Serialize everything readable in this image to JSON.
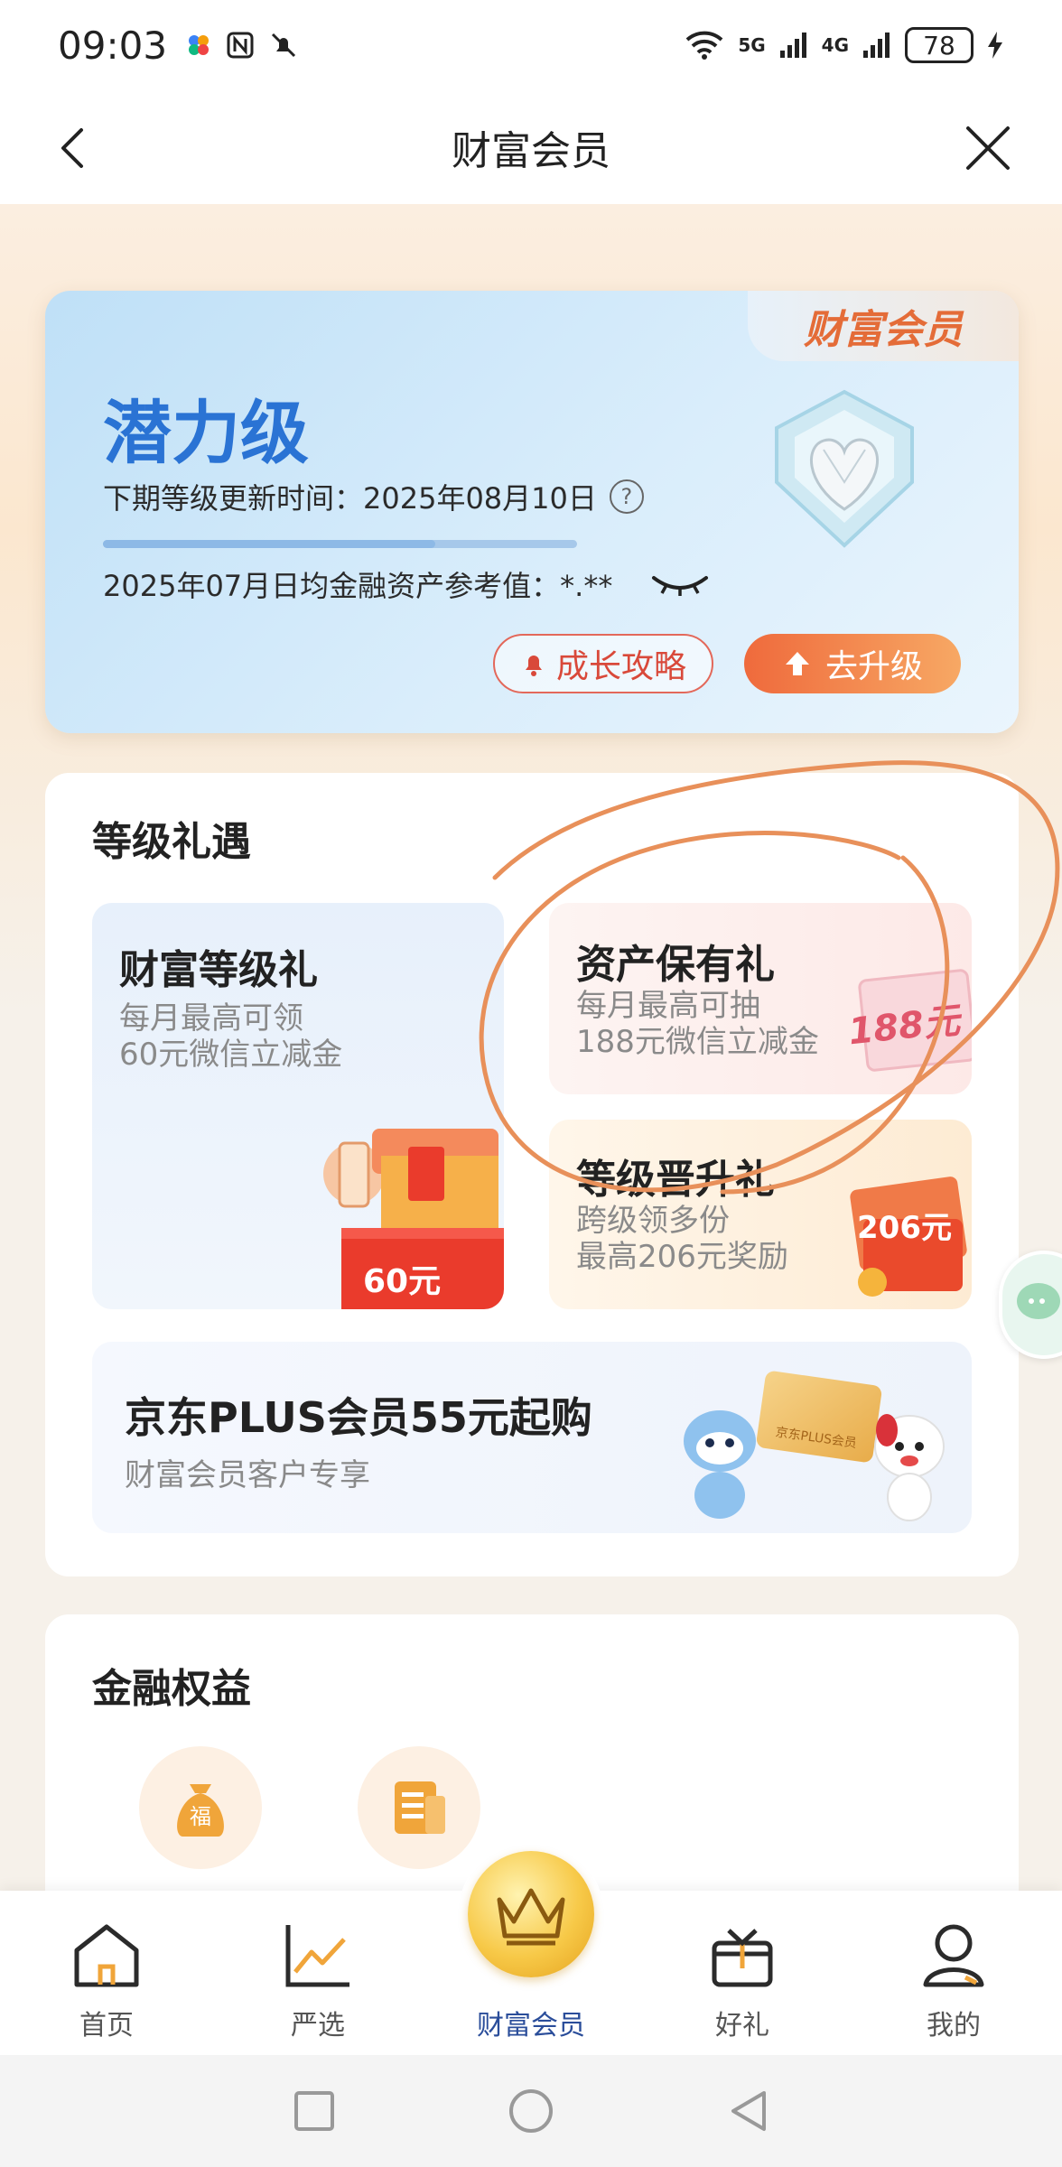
{
  "status_bar": {
    "time": "09:03",
    "network_5g": "5G",
    "network_4g": "4G",
    "battery": "78"
  },
  "nav": {
    "title": "财富会员"
  },
  "member_card": {
    "tag": "财富会员",
    "level": "潜力级",
    "update_time": "下期等级更新时间：2025年08月10日",
    "asset_reference": "2025年07月日均金融资产参考值：*.**",
    "progress": 0.7,
    "growth_button": "成长攻略",
    "upgrade_button": "去升级"
  },
  "benefits": {
    "title": "等级礼遇",
    "wealth_gift": {
      "title": "财富等级礼",
      "line1": "每月最高可领",
      "line2": "60元微信立减金",
      "badge": "60元"
    },
    "asset_gift": {
      "title": "资产保有礼",
      "line1": "每月最高可抽",
      "line2": "188元微信立减金",
      "badge": "188元"
    },
    "upgrade_gift": {
      "title": "等级晋升礼",
      "line1": "跨级领多份",
      "line2": "最高206元奖励",
      "badge": "206元"
    },
    "plus": {
      "title": "京东PLUS会员55元起购",
      "subtitle": "财富会员客户专享",
      "card_label": "京东PLUS会员"
    }
  },
  "finance": {
    "title": "金融权益",
    "icon1_char": "福"
  },
  "tabbar": {
    "items": [
      {
        "label": "首页",
        "icon": "home-icon"
      },
      {
        "label": "严选",
        "icon": "chart-icon"
      },
      {
        "label": "财富会员",
        "icon": "crown-icon"
      },
      {
        "label": "好礼",
        "icon": "gift-icon"
      },
      {
        "label": "我的",
        "icon": "user-icon"
      }
    ]
  },
  "colors": {
    "accent_blue": "#2a73d4",
    "accent_orange": "#ef6a3c",
    "annotation": "#e8905a"
  }
}
